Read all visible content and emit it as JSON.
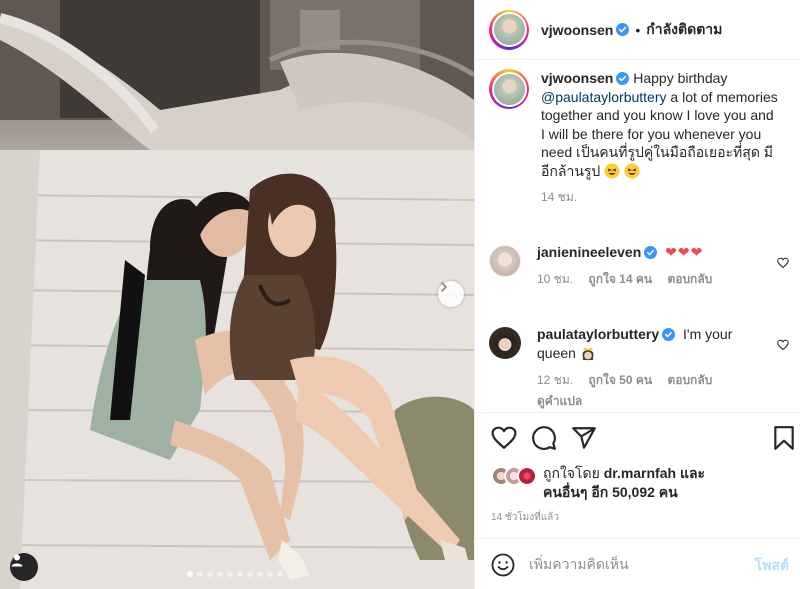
{
  "post_author": {
    "username": "vjwoonsen",
    "follow_status": "กำลังติดตาม",
    "separator": "•"
  },
  "caption": {
    "username": "vjwoonsen",
    "mention": "@paulataylorbuttery",
    "text_before_mention": "Happy birthday",
    "text_after_mention": "a lot of memories together and you know I love you and I will be there for you whenever you need เป็นคนที่รูปคู่ในมือถือเยอะที่สุด มีอีกล้านรูป",
    "time": "14 ชม."
  },
  "comments": [
    {
      "username": "janienineeleven",
      "text": "❤❤❤",
      "time": "10 ชม.",
      "likes": "ถูกใจ 14 คน",
      "reply": "ตอบกลับ",
      "verified": true
    },
    {
      "username": "paulataylorbuttery",
      "text": "I'm your queen",
      "time": "12 ชม.",
      "likes": "ถูกใจ 50 คน",
      "reply": "ตอบกลับ",
      "translate": "ดูคำแปล",
      "verified": true
    }
  ],
  "likes_summary": {
    "prefix": "ถูกใจโดย",
    "user": "dr.marnfah",
    "connector": "และ",
    "others": "คนอื่นๆ อีก 50,092 คน"
  },
  "post_time": "14 ชั่วโมงที่แล้ว",
  "add_comment": {
    "placeholder": "เพิ่มความคิดเห็น",
    "post_label": "โพสต์"
  },
  "carousel": {
    "total_slides": 10,
    "active_index": 0
  },
  "colors": {
    "verified": "#3897f0",
    "heart": "#ed4956",
    "link": "#00376b",
    "muted": "#8e8e8e",
    "post_disabled": "#b2dffc"
  },
  "icons": [
    "verified-badge-icon",
    "heart-icon",
    "comment-icon",
    "share-icon",
    "bookmark-icon",
    "smile-icon",
    "chevron-right-icon",
    "user-tag-icon"
  ]
}
